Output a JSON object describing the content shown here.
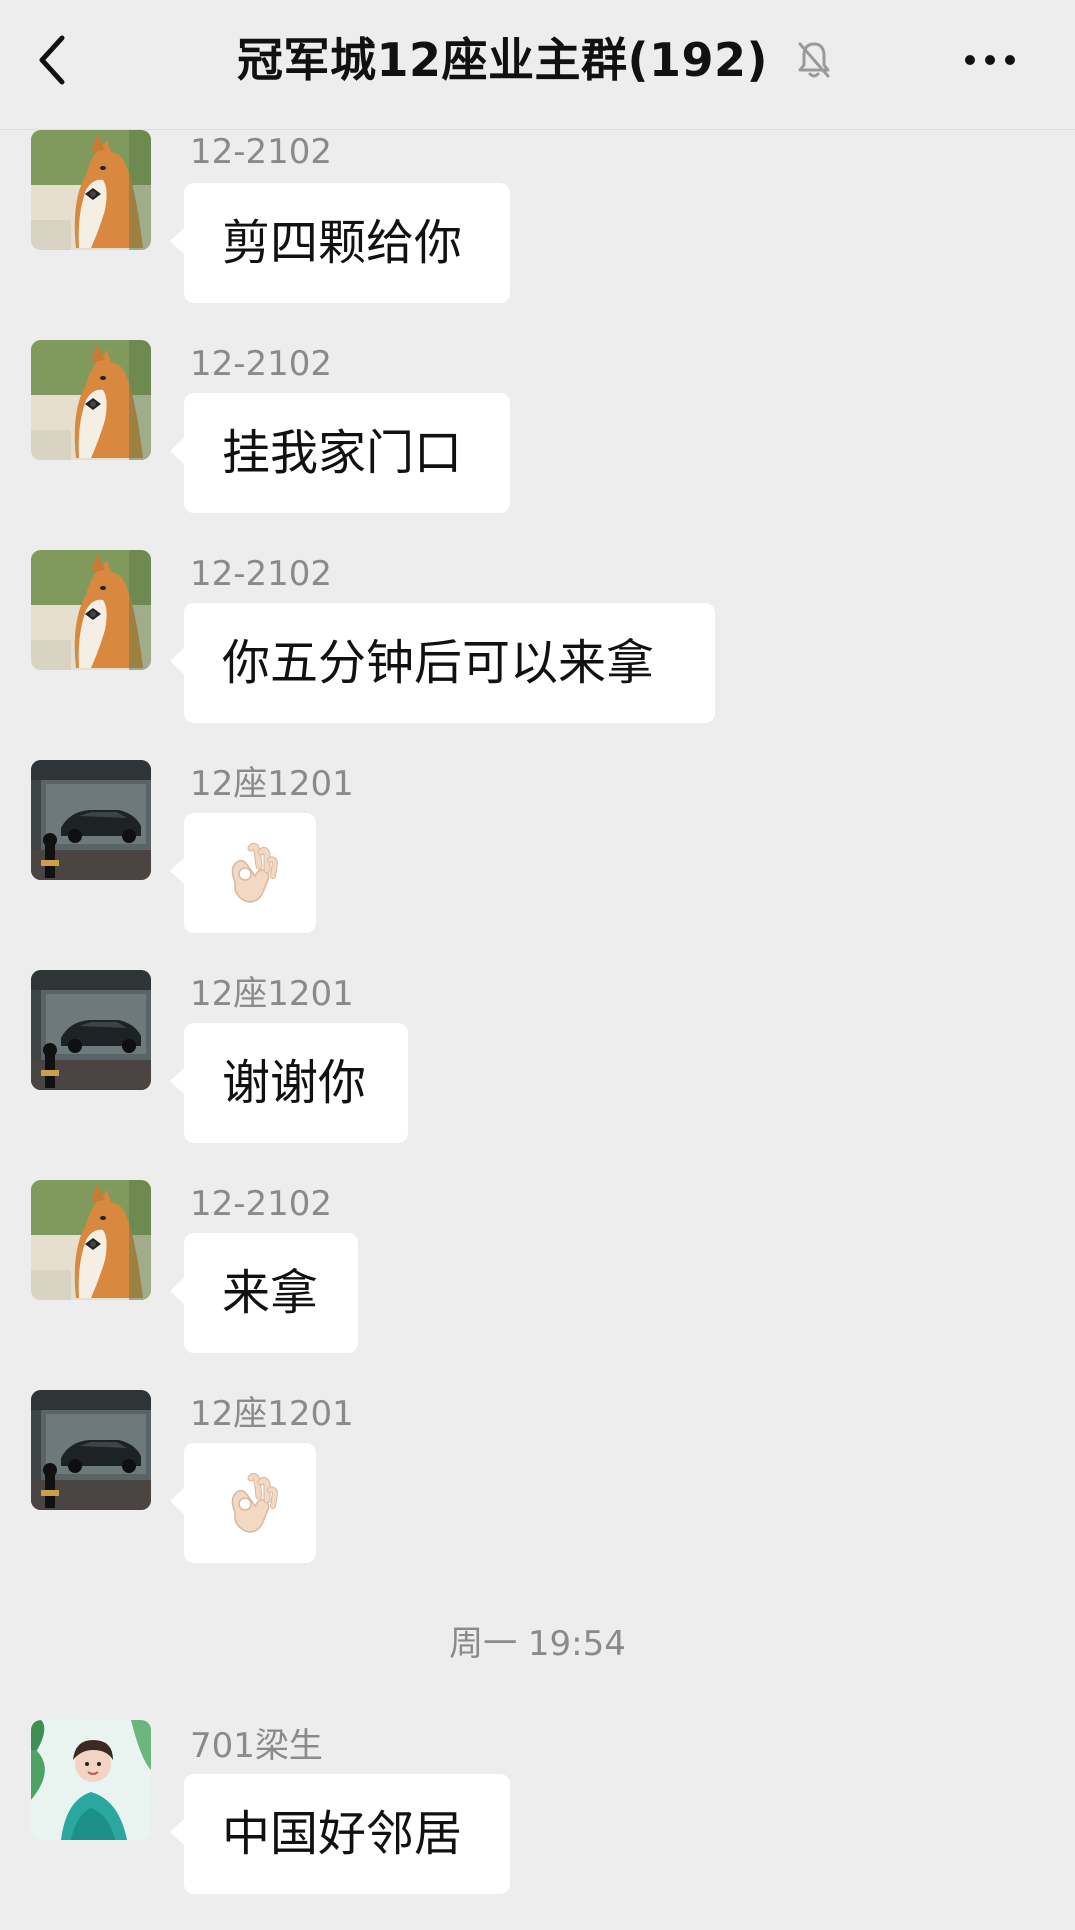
{
  "header": {
    "title": "冠军城12座业主群(192)",
    "back_icon": "chevron-left-icon",
    "mute_icon": "bell-off-icon",
    "more_icon": "more-dots-icon"
  },
  "messages": [
    {
      "sender": "12-2102",
      "text": "剪四颗给你",
      "avatar": "corgi-avatar"
    },
    {
      "sender": "12-2102",
      "text": "挂我家门口",
      "avatar": "corgi-avatar"
    },
    {
      "sender": "12-2102",
      "text": "你五分钟后可以来拿",
      "avatar": "corgi-avatar"
    },
    {
      "sender": "12座1201",
      "text": "",
      "emoji": "ok-hand-emoji",
      "avatar": "car-avatar"
    },
    {
      "sender": "12座1201",
      "text": "谢谢你",
      "avatar": "car-avatar"
    },
    {
      "sender": "12-2102",
      "text": "来拿",
      "avatar": "corgi-avatar"
    },
    {
      "sender": "12座1201",
      "text": "",
      "emoji": "ok-hand-emoji",
      "avatar": "car-avatar"
    },
    {
      "sender": "701梁生",
      "text": "中国好邻居",
      "avatar": "child-avatar"
    }
  ],
  "time_divider": "周一 19:54",
  "colors": {
    "background": "#ededed",
    "bubble": "#ffffff",
    "sender_text": "#8a8a8a",
    "message_text": "#111111"
  }
}
